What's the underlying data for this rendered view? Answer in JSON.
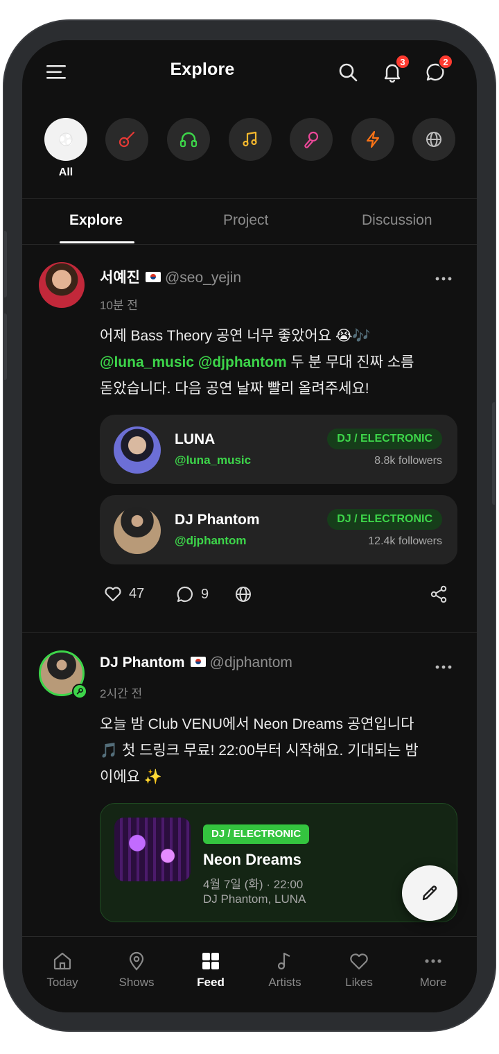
{
  "header": {
    "title": "Explore",
    "notifications_count": "3",
    "messages_count": "2"
  },
  "categories": [
    {
      "label": "All",
      "icon": "sparkle-icon",
      "active": true
    },
    {
      "icon": "guitar-icon",
      "color": "#e53935"
    },
    {
      "icon": "headphones-icon",
      "color": "#3dd64a"
    },
    {
      "icon": "music-note-icon",
      "color": "#f5b82e"
    },
    {
      "icon": "microphone-icon",
      "color": "#ec4899"
    },
    {
      "icon": "lightning-icon",
      "color": "#f97316"
    },
    {
      "icon": "globe-icon",
      "color": "#bdbdbd"
    }
  ],
  "tabs": [
    {
      "label": "Explore",
      "active": true
    },
    {
      "label": "Project"
    },
    {
      "label": "Discussion"
    }
  ],
  "posts": [
    {
      "author": "서예진",
      "handle": "@seo_yejin",
      "time": "10분 전",
      "text_line1": "어제 Bass Theory 공연 너무 좋았어요 😭🎶",
      "mention1": "@luna_music",
      "mention2": "@djphantom",
      "text_line2_rest": " 두 분 무대 진짜 소름",
      "text_line3": "돋았습니다. 다음 공연 날짜 빨리 올려주세요!",
      "artists": [
        {
          "name": "LUNA",
          "handle": "@luna_music",
          "genre": "DJ / ELECTRONIC",
          "followers": "8.8k followers"
        },
        {
          "name": "DJ Phantom",
          "handle": "@djphantom",
          "genre": "DJ / ELECTRONIC",
          "followers": "12.4k followers"
        }
      ],
      "likes": "47",
      "comments": "9"
    },
    {
      "author": "DJ Phantom",
      "handle": "@djphantom",
      "time": "2시간 전",
      "text_line1": "오늘 밤 Club VENU에서 Neon Dreams 공연입니다",
      "text_line2": "🎵 첫 드링크 무료! 22:00부터 시작해요. 기대되는 밤",
      "text_line3": "이에요 ✨",
      "event": {
        "genre": "DJ / ELECTRONIC",
        "title": "Neon Dreams",
        "date": "4월 7일 (화) · 22:00",
        "artists": "DJ Phantom, LUNA"
      }
    }
  ],
  "bottom_nav": [
    {
      "label": "Today",
      "icon": "home-icon"
    },
    {
      "label": "Shows",
      "icon": "location-pin-icon"
    },
    {
      "label": "Feed",
      "icon": "grid-icon",
      "active": true
    },
    {
      "label": "Artists",
      "icon": "music-note-icon"
    },
    {
      "label": "Likes",
      "icon": "heart-icon"
    },
    {
      "label": "More",
      "icon": "more-dots-icon"
    }
  ],
  "accent_color": "#3dd64a"
}
